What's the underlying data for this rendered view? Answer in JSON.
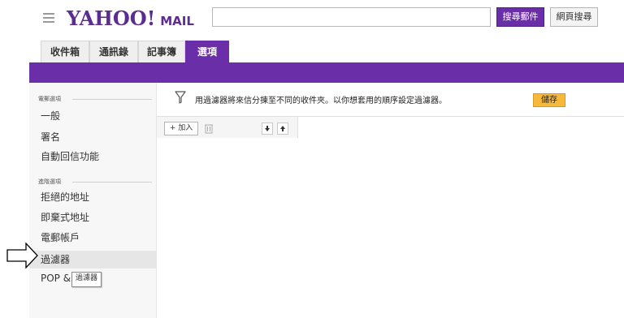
{
  "header": {
    "logo_main": "YAHOO!",
    "logo_sub": "MAIL",
    "search": {
      "value": "",
      "placeholder": ""
    },
    "mail_search_label": "搜尋郵件",
    "web_search_label": "網頁搜尋"
  },
  "tabs": [
    {
      "label": "收件箱",
      "active": false
    },
    {
      "label": "通訊錄",
      "active": false
    },
    {
      "label": "記事簿",
      "active": false
    },
    {
      "label": "選項",
      "active": true
    }
  ],
  "sidebar": {
    "groups": [
      {
        "heading": "電郵選項",
        "items": [
          "一般",
          "署名",
          "自動回信功能"
        ]
      },
      {
        "heading": "進階選項",
        "items": [
          "拒絕的地址",
          "即棄式地址",
          "電郵帳戶",
          "過濾器",
          "POP & 轉寄"
        ]
      }
    ],
    "selected": "過濾器"
  },
  "main": {
    "notice": "用過濾器將來信分揀至不同的收件夾。以你想套用的順序設定過濾器。",
    "save_label": "儲存",
    "add_label": "+ 加入"
  },
  "tooltip": "過濾器",
  "colors": {
    "brand": "#6a2fa8",
    "save_button": "#f6b93b"
  },
  "icons": [
    "menu-icon",
    "filter-icon",
    "trash-icon",
    "arrow-down-icon",
    "arrow-up-icon",
    "pointer-arrow-icon"
  ]
}
